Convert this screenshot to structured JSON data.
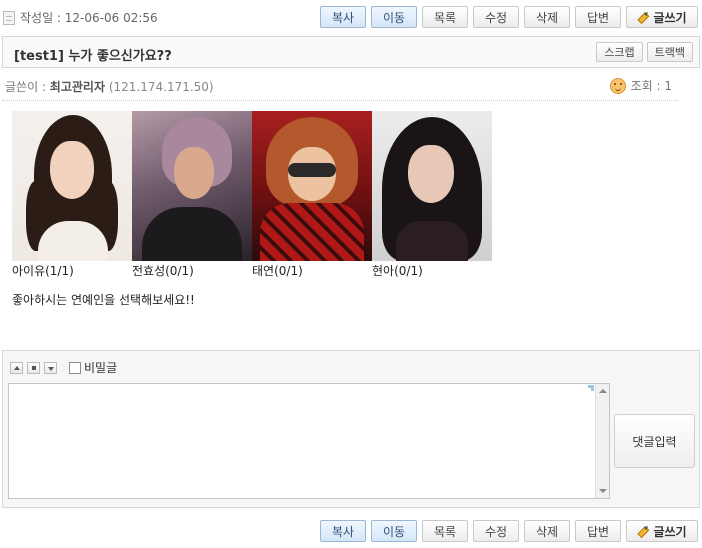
{
  "post": {
    "date_label": "작성일 : 12-06-06 02:56",
    "title": "[test1] 누가 좋으신가요??",
    "author_label": "글쓴이 : ",
    "author": "최고관리자",
    "ip": "(121.174.171.50)",
    "views_label": "조회 : 1",
    "message": "좋아하시는 연예인을 선택해보세요!!"
  },
  "toolbar": {
    "copy": "복사",
    "move": "이동",
    "list": "목록",
    "edit": "수정",
    "delete": "삭제",
    "reply": "답변",
    "write": "글쓰기"
  },
  "title_actions": {
    "scrap": "스크랩",
    "trackback": "트랙백"
  },
  "photos": [
    {
      "caption": "아이유(1/1)"
    },
    {
      "caption": "전효성(0/1)"
    },
    {
      "caption": "태연(0/1)"
    },
    {
      "caption": "현아(0/1)"
    }
  ],
  "comment": {
    "secret_label": "비밀글",
    "submit_label": "댓글입력",
    "text": ""
  },
  "colors": {
    "accent_button": "#d5e6f8",
    "accent_border": "#9bb7d6"
  }
}
